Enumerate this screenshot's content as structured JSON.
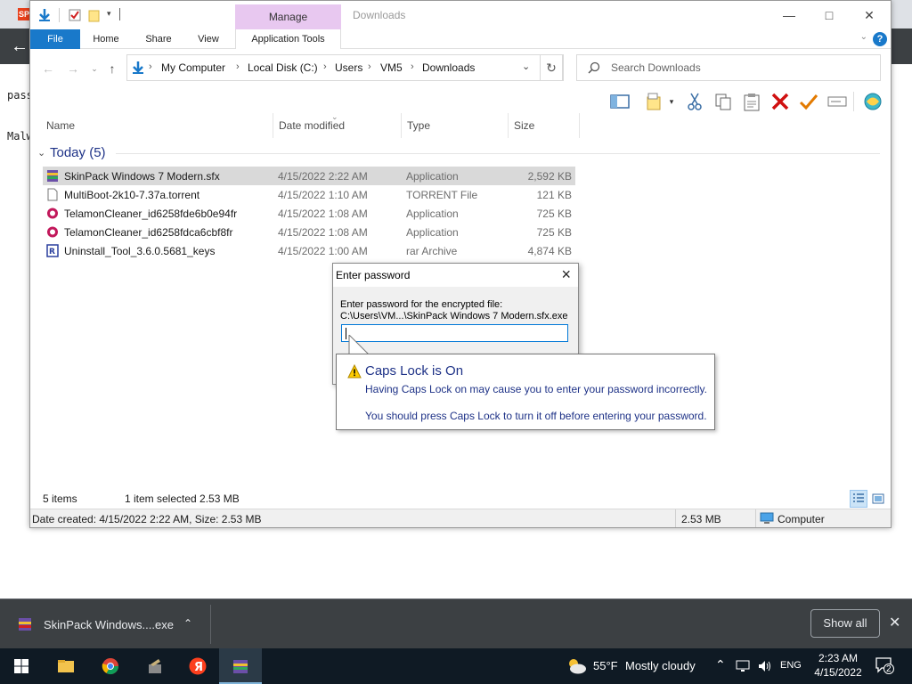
{
  "background_page": {
    "line1": "pass",
    "line2": "Malw"
  },
  "explorer": {
    "title": "Downloads",
    "manage_tab": "Manage",
    "ribbon_tabs": [
      "File",
      "Home",
      "Share",
      "View",
      "Application Tools"
    ],
    "help_label": "?",
    "breadcrumbs": [
      "My Computer",
      "Local Disk (C:)",
      "Users",
      "VM5",
      "Downloads"
    ],
    "search_placeholder": "Search Downloads",
    "columns": {
      "name": "Name",
      "date": "Date modified",
      "type": "Type",
      "size": "Size"
    },
    "group_label": "Today (5)",
    "files": [
      {
        "name": "SkinPack Windows 7 Modern.sfx",
        "date": "4/15/2022 2:22 AM",
        "type": "Application",
        "size": "2,592 KB",
        "icon": "skinpack-archive-icon",
        "selected": true
      },
      {
        "name": "MultiBoot-2k10-7.37a.torrent",
        "date": "4/15/2022 1:10 AM",
        "type": "TORRENT File",
        "size": "121 KB",
        "icon": "blank-file-icon",
        "selected": false
      },
      {
        "name": "TelamonCleaner_id6258fde6b0e94fr",
        "date": "4/15/2022 1:08 AM",
        "type": "Application",
        "size": "725 KB",
        "icon": "telamon-app-icon",
        "selected": false
      },
      {
        "name": "TelamonCleaner_id6258fdca6cbf8fr",
        "date": "4/15/2022 1:08 AM",
        "type": "Application",
        "size": "725 KB",
        "icon": "telamon-app-icon",
        "selected": false
      },
      {
        "name": "Uninstall_Tool_3.6.0.5681_keys",
        "date": "4/15/2022 1:00 AM",
        "type": "rar Archive",
        "size": "4,874 KB",
        "icon": "rar-archive-icon",
        "selected": false
      }
    ],
    "status": {
      "items": "5 items",
      "selected": "1 item selected  2.53 MB"
    },
    "details": {
      "info": "Date created: 4/15/2022 2:22 AM, Size: 2.53 MB",
      "size": "2.53 MB",
      "location": "Computer"
    }
  },
  "password_dialog": {
    "title": "Enter password",
    "label": "Enter password for the encrypted file:",
    "path": "C:\\Users\\VM...\\SkinPack Windows 7 Modern.sfx.exe",
    "value": ""
  },
  "capslock_tip": {
    "title": "Caps Lock is On",
    "line1": "Having Caps Lock on may cause you to enter your password incorrectly.",
    "line2": "You should press Caps Lock to turn it off before entering your password."
  },
  "download_bar": {
    "file": "SkinPack Windows....exe",
    "show_all": "Show all"
  },
  "taskbar": {
    "weather_temp": "55°F",
    "weather_desc": "Mostly cloudy",
    "language": "ENG",
    "time": "2:23 AM",
    "date": "4/15/2022",
    "notifications": "2"
  },
  "colors": {
    "accent": "#1979ca",
    "manage": "#e8c8f0",
    "selection": "#d9d9d9",
    "tip_text": "#1e3287",
    "taskbar": "#0f1a24",
    "downloadbar": "#3c4043"
  }
}
